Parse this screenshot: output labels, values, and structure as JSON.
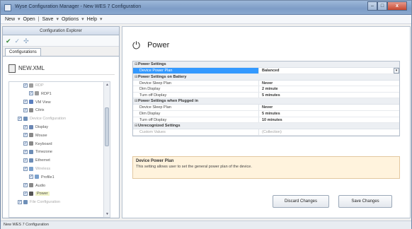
{
  "window": {
    "title": "Wyse Configuration Manager - New WES 7 Configuration",
    "controls": [
      "–",
      "□",
      "x"
    ]
  },
  "menu": {
    "items": [
      "New",
      "Open",
      "Save",
      "Options",
      "Help"
    ]
  },
  "explorer": {
    "header": "Configuration Explorer",
    "tab": "Configurations",
    "file_name": "NEW.XML",
    "tree": [
      {
        "label": "RDP",
        "indent": 1,
        "icon_color": "#9c9c9c",
        "dim": true
      },
      {
        "label": "RDP1",
        "indent": 2,
        "icon_color": "#9c9c9c",
        "dim": false
      },
      {
        "label": "VM View",
        "indent": 1,
        "icon_color": "#5b7fbf",
        "dim": false
      },
      {
        "label": "Citrix",
        "indent": 1,
        "icon_color": "#8a8a8a",
        "dim": false
      },
      {
        "label": "Device Configuration",
        "indent": 0,
        "icon_color": "#6e8fb8",
        "dim": true
      },
      {
        "label": "Display",
        "indent": 1,
        "icon_color": "#6a86b3",
        "dim": false
      },
      {
        "label": "Mouse",
        "indent": 1,
        "icon_color": "#888888",
        "dim": false
      },
      {
        "label": "Keyboard",
        "indent": 1,
        "icon_color": "#888888",
        "dim": false
      },
      {
        "label": "Timezone",
        "indent": 1,
        "icon_color": "#6d8db6",
        "dim": false
      },
      {
        "label": "Ethernet",
        "indent": 1,
        "icon_color": "#6d8db6",
        "dim": false
      },
      {
        "label": "Wireless",
        "indent": 1,
        "icon_color": "#7aa0cc",
        "dim": true
      },
      {
        "label": "Profile1",
        "indent": 2,
        "icon_color": "#7aa0cc",
        "dim": false
      },
      {
        "label": "Audio",
        "indent": 1,
        "icon_color": "#888888",
        "dim": false
      },
      {
        "label": "Power",
        "indent": 1,
        "icon_color": "#555555",
        "dim": false,
        "selected": true
      },
      {
        "label": "File Configuration",
        "indent": 0,
        "icon_color": "#6e8fb8",
        "dim": true
      }
    ]
  },
  "page": {
    "title": "Power",
    "icon": "power-plug-icon"
  },
  "grid": {
    "sections": [
      {
        "title": "Power Settings",
        "rows": [
          {
            "name": "Device Power Plan",
            "value": "Balanced",
            "selected": true,
            "dropdown": true
          }
        ]
      },
      {
        "title": "Power Settings on Battery",
        "rows": [
          {
            "name": "Device Sleep Plan",
            "value": "Never"
          },
          {
            "name": "Dim Display",
            "value": "2 minute"
          },
          {
            "name": "Turn off Display",
            "value": "5 minutes"
          }
        ]
      },
      {
        "title": "Power Settings when Plugged in",
        "rows": [
          {
            "name": "Device Sleep Plan",
            "value": "Never"
          },
          {
            "name": "Dim Display",
            "value": "5 minutes"
          },
          {
            "name": "Turn off Display",
            "value": "10 minutes"
          }
        ]
      },
      {
        "title": "Unrecognized Settings",
        "rows": [
          {
            "name": "Custom Values",
            "value": "(Collection)",
            "dim": true
          }
        ]
      }
    ]
  },
  "description": {
    "title": "Device Power Plan",
    "text": "This setting allows user to set the general power plan of the device."
  },
  "buttons": {
    "discard": "Discard Changes",
    "save": "Save Changes"
  },
  "status": {
    "text": "New WES 7 Configuration"
  }
}
